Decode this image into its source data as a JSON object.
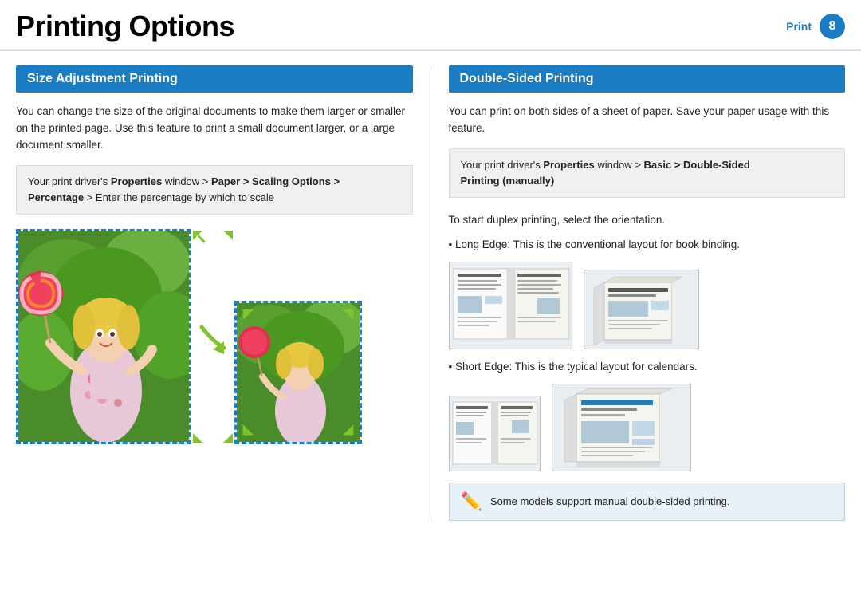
{
  "header": {
    "title": "Printing Options",
    "print_label": "Print",
    "page_number": "8"
  },
  "left_section": {
    "header": "Size Adjustment Printing",
    "description": "You can change the size of the original documents to make them larger or smaller on the printed page. Use this feature to print a small document larger, or a large document smaller.",
    "instruction": {
      "prefix": "Your print driver’s ",
      "properties": "Properties",
      "middle1": " window > ",
      "bold1": "Paper > Scaling Options >",
      "bold2": "Percentage",
      "suffix": " > Enter the percentage by which to scale"
    }
  },
  "right_section": {
    "header": "Double-Sided Printing",
    "description": "You can print on both sides of a sheet of paper.  Save your paper usage with this feature.",
    "instruction": {
      "prefix": "Your print driver’s ",
      "properties": "Properties",
      "middle": " window > ",
      "bold": "Basic > Double-Sided Printing (manually)"
    },
    "long_edge_label": "To start duplex printing, select the orientation.",
    "long_edge_desc": "• Long Edge: This is the conventional layout for book binding.",
    "short_edge_desc": "• Short Edge: This is the typical layout for calendars.",
    "note": "Some models support manual double-sided printing."
  },
  "icons": {
    "note_icon": "📝",
    "arrow_up_left": "↖",
    "arrow_up_right": "↗",
    "arrow_down_left": "↙",
    "arrow_down_right": "↘"
  }
}
